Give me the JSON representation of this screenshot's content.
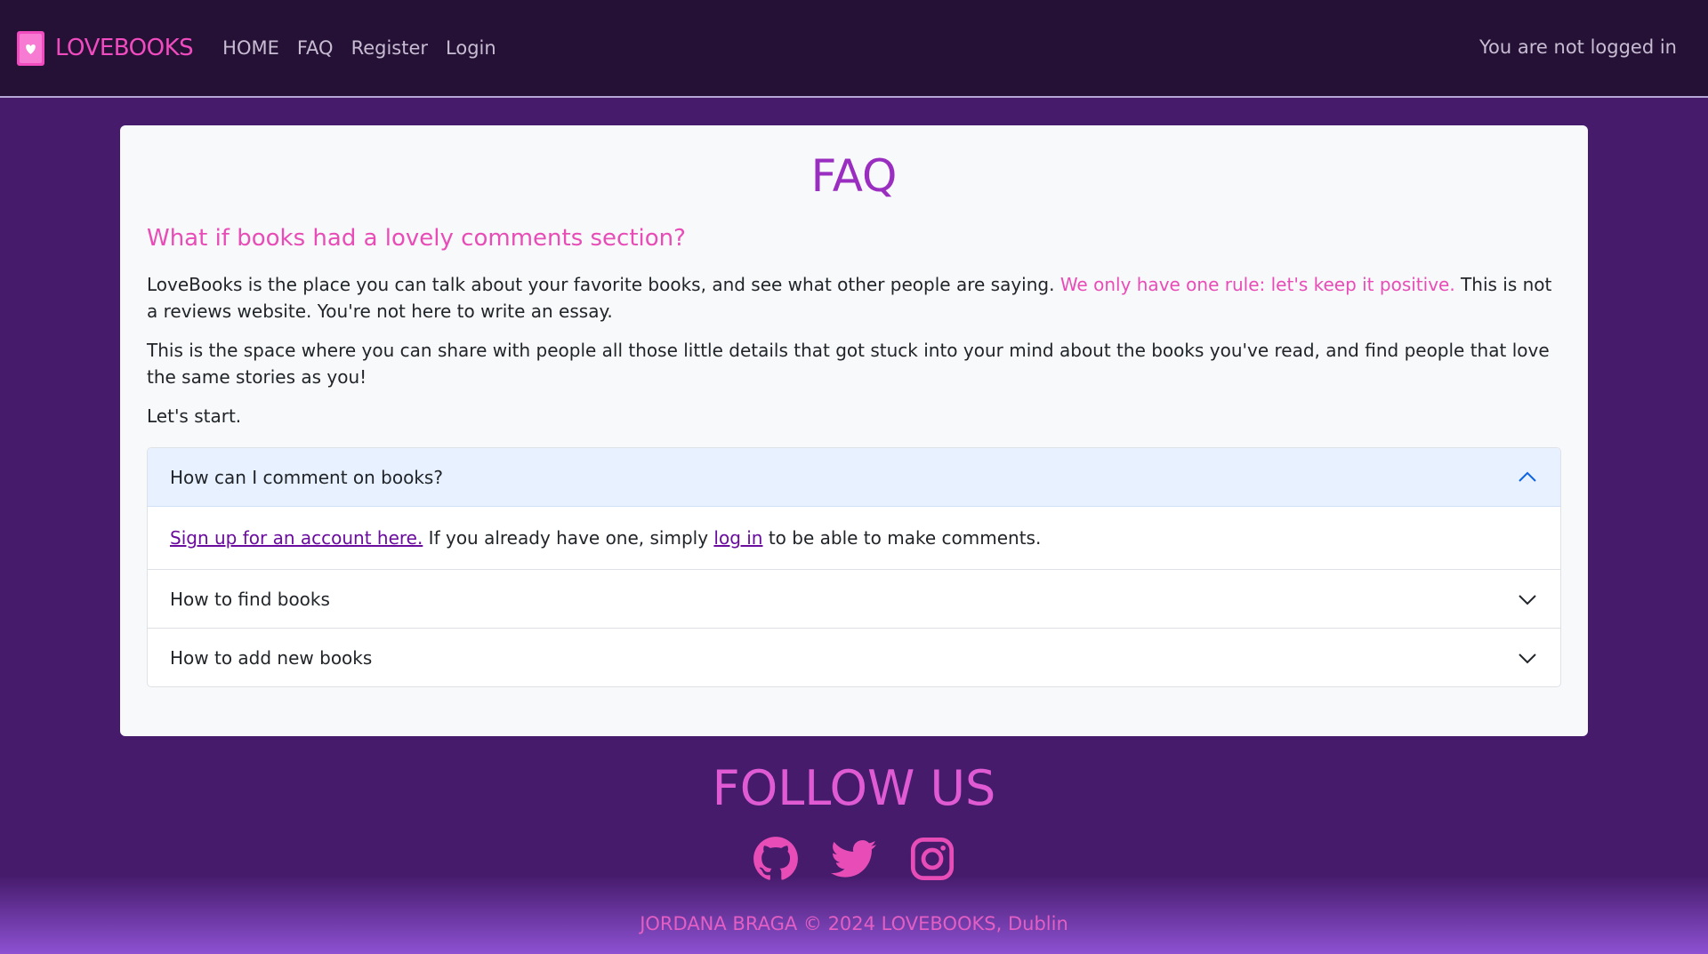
{
  "nav": {
    "brand": "LOVEBOOKS",
    "links": [
      "HOME",
      "FAQ",
      "Register",
      "Login"
    ],
    "status": "You are not logged in"
  },
  "faq": {
    "title": "FAQ",
    "subtitle": "What if books had a lovely comments section?",
    "p1_before": "LoveBooks is the place you can talk about your favorite books, and see what other people are saying. ",
    "p1_highlight": "We only have one rule: let's keep it positive.",
    "p1_after": " This is not a reviews website. You're not here to write an essay.",
    "p2": "This is the space where you can share with people all those little details that got stuck into your mind about the books you've read, and find people that love the same stories as you!",
    "p3": "Let's start.",
    "accordion": [
      {
        "question": "How can I comment on books?",
        "open": true,
        "answer_link1": "Sign up for an account here.",
        "answer_mid": " If you already have one, simply ",
        "answer_link2": "log in",
        "answer_end": " to be able to make comments."
      },
      {
        "question": "How to find books",
        "open": false
      },
      {
        "question": "How to add new books",
        "open": false
      }
    ]
  },
  "footer": {
    "follow": "FOLLOW US",
    "social_icons": [
      "github-icon",
      "twitter-icon",
      "instagram-icon"
    ],
    "copyright": "JORDANA BRAGA © 2024 LOVEBOOKS, Dublin"
  },
  "colors": {
    "navbar_bg": "#261136",
    "page_bg": "#461b6c",
    "brand_pink": "#f04bbf",
    "title_purple": "#9a2ec0",
    "footer_gradient_end": "#8d51d2"
  }
}
